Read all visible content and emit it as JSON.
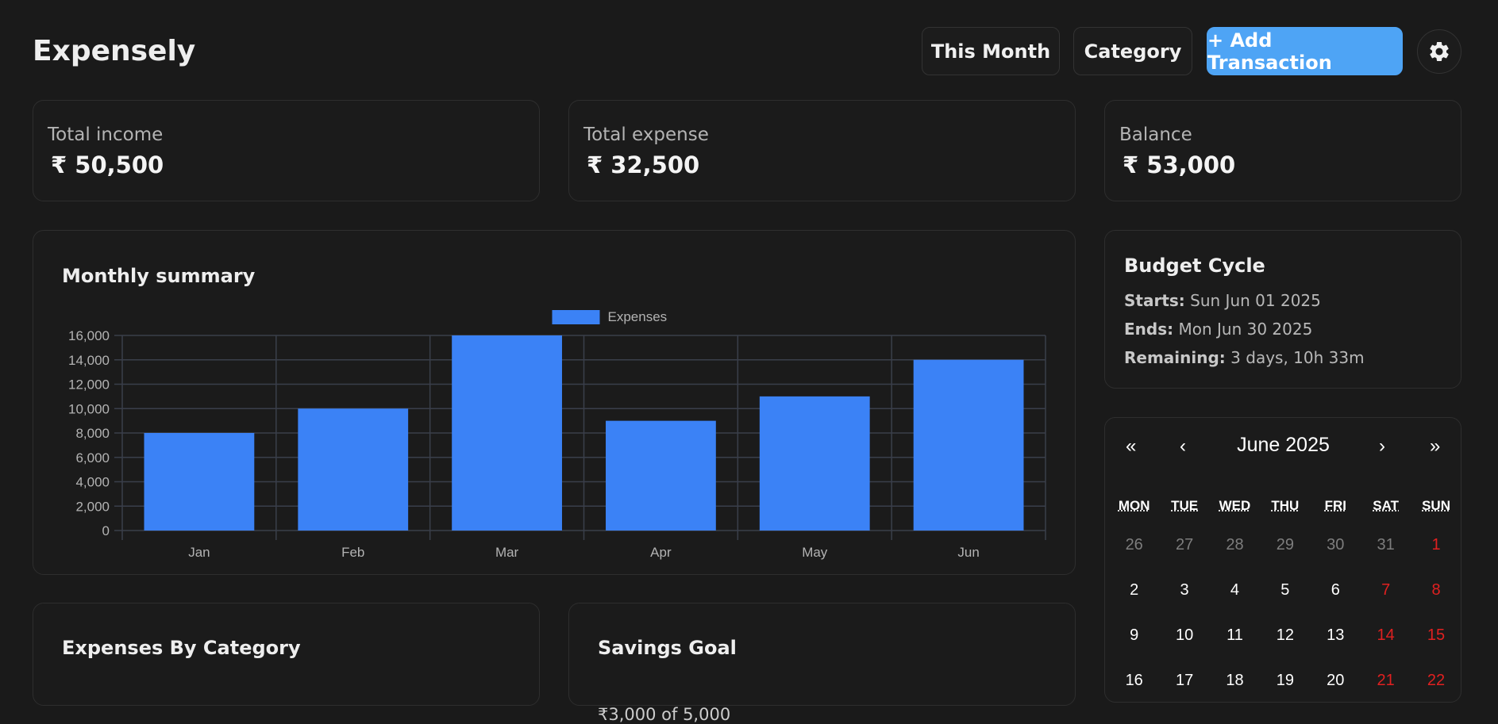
{
  "app": {
    "title": "Expensely"
  },
  "header": {
    "this_month_label": "This Month",
    "category_label": "Category",
    "add_label": "+ Add Transaction",
    "settings_icon": "gear-icon"
  },
  "stats": {
    "income": {
      "label": "Total income",
      "value": "₹ 50,500"
    },
    "expense": {
      "label": "Total expense",
      "value": "₹ 32,500"
    },
    "balance": {
      "label": "Balance",
      "value": "₹ 53,000"
    }
  },
  "monthly": {
    "title": "Monthly summary"
  },
  "chart_data": {
    "type": "bar",
    "categories": [
      "Jan",
      "Feb",
      "Mar",
      "Apr",
      "May",
      "Jun"
    ],
    "series": [
      {
        "name": "Expenses",
        "values": [
          8000,
          10000,
          16000,
          9000,
          11000,
          14000
        ]
      }
    ],
    "ylim": [
      0,
      16000
    ],
    "yticks": [
      0,
      2000,
      4000,
      6000,
      8000,
      10000,
      12000,
      14000,
      16000
    ],
    "ytick_labels": [
      "0",
      "2,000",
      "4,000",
      "6,000",
      "8,000",
      "10,000",
      "12,000",
      "14,000",
      "16,000"
    ],
    "grid": true,
    "legend": "top-center",
    "colors": {
      "bar": "#3b82f6",
      "grid": "#3a3f4b",
      "text": "#b3b3b3"
    }
  },
  "budget": {
    "title": "Budget Cycle",
    "starts_label": "Starts:",
    "starts_value": "Sun Jun 01 2025",
    "ends_label": "Ends:",
    "ends_value": "Mon Jun 30 2025",
    "remaining_label": "Remaining:",
    "remaining_value": "3 days, 10h 33m"
  },
  "calendar": {
    "month": "June 2025",
    "nav": {
      "prev_year": "«",
      "prev": "‹",
      "next": "›",
      "next_year": "»"
    },
    "weekdays": [
      "MON",
      "TUE",
      "WED",
      "THU",
      "FRI",
      "SAT",
      "SUN"
    ],
    "weeks": [
      [
        "26",
        "27",
        "28",
        "29",
        "30",
        "31",
        "1"
      ],
      [
        "2",
        "3",
        "4",
        "5",
        "6",
        "7",
        "8"
      ],
      [
        "9",
        "10",
        "11",
        "12",
        "13",
        "14",
        "15"
      ],
      [
        "16",
        "17",
        "18",
        "19",
        "20",
        "21",
        "22"
      ]
    ]
  },
  "categories_card": {
    "title": "Expenses By Category"
  },
  "savings": {
    "title": "Savings Goal",
    "progress_text": "₹3,000 of 5,000"
  }
}
